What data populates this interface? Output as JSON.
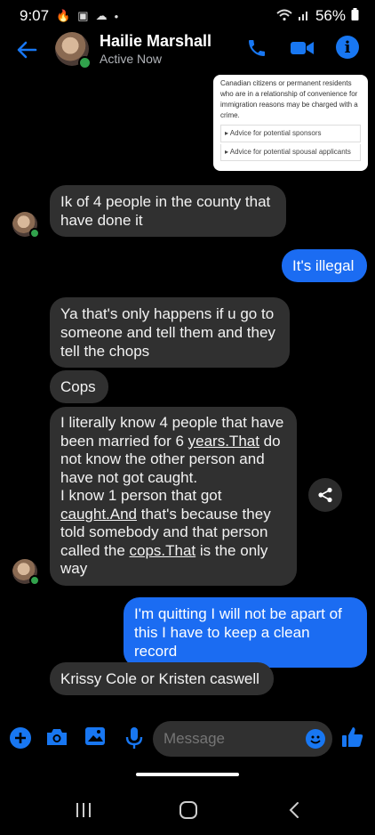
{
  "status_bar": {
    "time": "9:07",
    "battery": "56%"
  },
  "header": {
    "name": "Hailie Marshall",
    "status": "Active Now"
  },
  "card": {
    "text": "Canadian citizens or permanent residents who are in a relationship of convenience for immigration reasons may be charged with a crime.",
    "links": [
      "Advice for potential sponsors",
      "Advice for potential spousal applicants"
    ]
  },
  "messages": {
    "m1": "Ik of 4 people in the county that have done it",
    "m2": "It's illegal",
    "m3": "Ya that's only happens if u go to someone and tell them and they tell the chops",
    "m4": "Cops",
    "m5": {
      "p1": "I literally know 4 people that have been married for 6 ",
      "l1": "years.That",
      "p2": " do not know the other person and have not got caught.",
      "p3": "I know 1 person that got ",
      "l2": "caught.And",
      "p4": " that's because they told somebody and that person called the ",
      "l3": "cops.That",
      "p5": " is the only way"
    },
    "m6": "I'm quitting I will not be apart of this I have to keep a clean record",
    "m7": "Krissy Cole or Kristen caswell"
  },
  "composer": {
    "placeholder": "Message"
  },
  "colors": {
    "accent": "#1877f2",
    "my_bubble": "#1b6cf2",
    "their_bubble": "#303030"
  }
}
